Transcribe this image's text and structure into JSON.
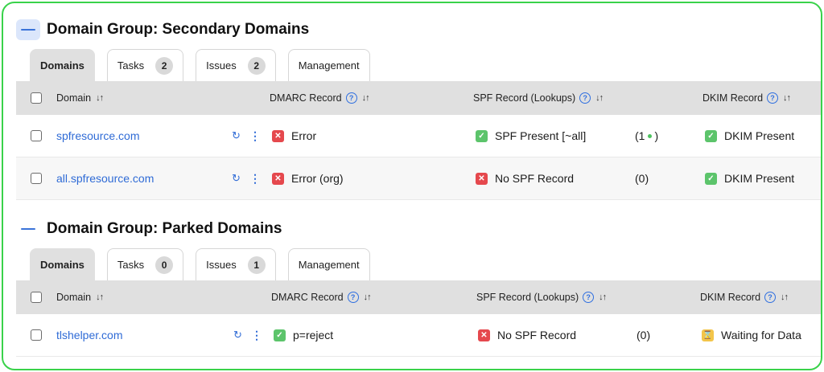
{
  "colors": {
    "accent": "#2f6bd6",
    "success": "#5cc46b",
    "error": "#e5484d",
    "warning": "#f3c54a",
    "frame": "#39d24a"
  },
  "groups": [
    {
      "title": "Domain Group: Secondary Domains",
      "tabs": [
        {
          "label": "Domains",
          "count": null
        },
        {
          "label": "Tasks",
          "count": "2"
        },
        {
          "label": "Issues",
          "count": "2"
        },
        {
          "label": "Management",
          "count": null
        }
      ],
      "columns": {
        "domain": "Domain",
        "dmarc": "DMARC Record",
        "spf": "SPF Record (Lookups)",
        "dkim": "DKIM Record"
      },
      "rows": [
        {
          "domain": "spfresource.com",
          "dmarc": "Error",
          "spf": "SPF Present [~all]",
          "lookups": "(1",
          "lookups_close": ")",
          "dkim": "DKIM Present"
        },
        {
          "domain": "all.spfresource.com",
          "dmarc": "Error (org)",
          "spf": "No SPF Record",
          "lookups": "(0)",
          "dkim": "DKIM Present"
        }
      ]
    },
    {
      "title": "Domain Group: Parked Domains",
      "tabs": [
        {
          "label": "Domains",
          "count": null
        },
        {
          "label": "Tasks",
          "count": "0"
        },
        {
          "label": "Issues",
          "count": "1"
        },
        {
          "label": "Management",
          "count": null
        }
      ],
      "columns": {
        "domain": "Domain",
        "dmarc": "DMARC Record",
        "spf": "SPF Record (Lookups)",
        "dkim": "DKIM Record"
      },
      "rows": [
        {
          "domain": "tlshelper.com",
          "dmarc": "p=reject",
          "spf": "No SPF Record",
          "lookups": "(0)",
          "dkim": "Waiting for Data"
        }
      ]
    }
  ],
  "icons": {
    "sort": "sort-arrows-icon",
    "help": "help-circle-icon",
    "refresh": "refresh-icon",
    "more": "kebab-menu-icon"
  }
}
